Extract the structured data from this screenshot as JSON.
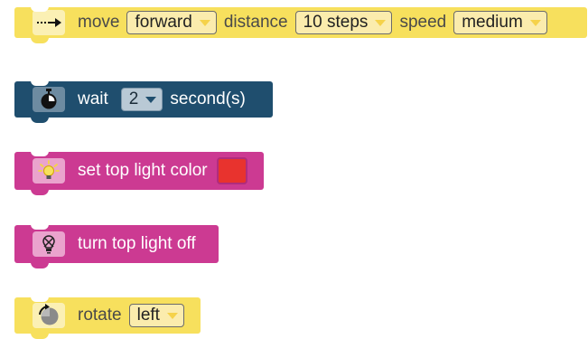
{
  "blocks": {
    "move": {
      "icon": "arrow-right-icon",
      "label_move": "move",
      "direction": "forward",
      "label_distance": "distance",
      "distance": "10 steps",
      "label_speed": "speed",
      "speed": "medium",
      "color": "#f7e05d"
    },
    "wait": {
      "icon": "stopwatch-icon",
      "label_wait": "wait",
      "seconds": "2",
      "label_unit": "second(s)",
      "color": "#1f4e6e"
    },
    "set_light": {
      "icon": "lightbulb-on-icon",
      "label": "set top light color",
      "light_color": "#e8332e",
      "color": "#cc3a92"
    },
    "light_off": {
      "icon": "lightbulb-off-icon",
      "label": "turn top light off",
      "color": "#cc3a92"
    },
    "rotate": {
      "icon": "rotate-icon",
      "label": "rotate",
      "direction": "left",
      "color": "#f7e05d"
    }
  }
}
